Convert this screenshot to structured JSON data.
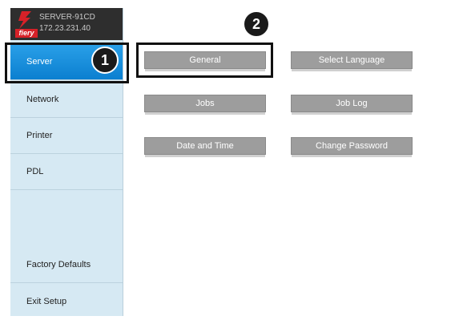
{
  "server": {
    "name": "SERVER-91CD",
    "ip": "172.23.231.40",
    "logo_text": "fiery"
  },
  "sidebar": {
    "items": [
      {
        "label": "Server"
      },
      {
        "label": "Network"
      },
      {
        "label": "Printer"
      },
      {
        "label": "PDL"
      },
      {
        "label": "Factory Defaults"
      },
      {
        "label": "Exit Setup"
      }
    ],
    "active_index": 0
  },
  "main": {
    "buttons": [
      {
        "label": "General"
      },
      {
        "label": "Select Language"
      },
      {
        "label": "Jobs"
      },
      {
        "label": "Job Log"
      },
      {
        "label": "Date and Time"
      },
      {
        "label": "Change Password"
      }
    ]
  },
  "callouts": {
    "one": "1",
    "two": "2"
  },
  "colors": {
    "active_nav": "#1591de",
    "sidebar_bg": "#d6e9f3",
    "button_bg": "#9d9d9d",
    "logo_red": "#d62128"
  }
}
